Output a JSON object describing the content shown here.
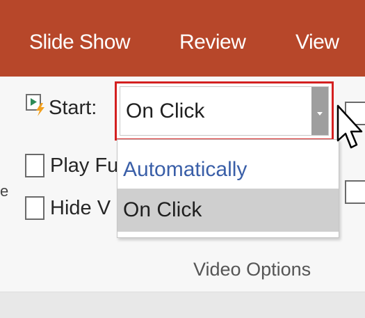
{
  "tabs": [
    {
      "label": "Slide Show"
    },
    {
      "label": "Review"
    },
    {
      "label": "View"
    }
  ],
  "video_options": {
    "start_label": "Start:",
    "start_value": "On Click",
    "options": [
      {
        "label": "Automatically"
      },
      {
        "label": "On Click",
        "selected": true
      }
    ],
    "play_label": "Play Fu",
    "hide_label": "Hide V",
    "group_label": "Video Options",
    "side_glyph": "e"
  },
  "colors": {
    "tab_bar": "#b7472a",
    "highlight_border": "#d42020",
    "option_link": "#3a5fa8",
    "selected_option": "#cfcfcf"
  },
  "icons": {
    "start": "animation-start-icon",
    "dropdown_arrow": "chevron-down-icon",
    "cursor": "mouse-pointer-icon"
  }
}
